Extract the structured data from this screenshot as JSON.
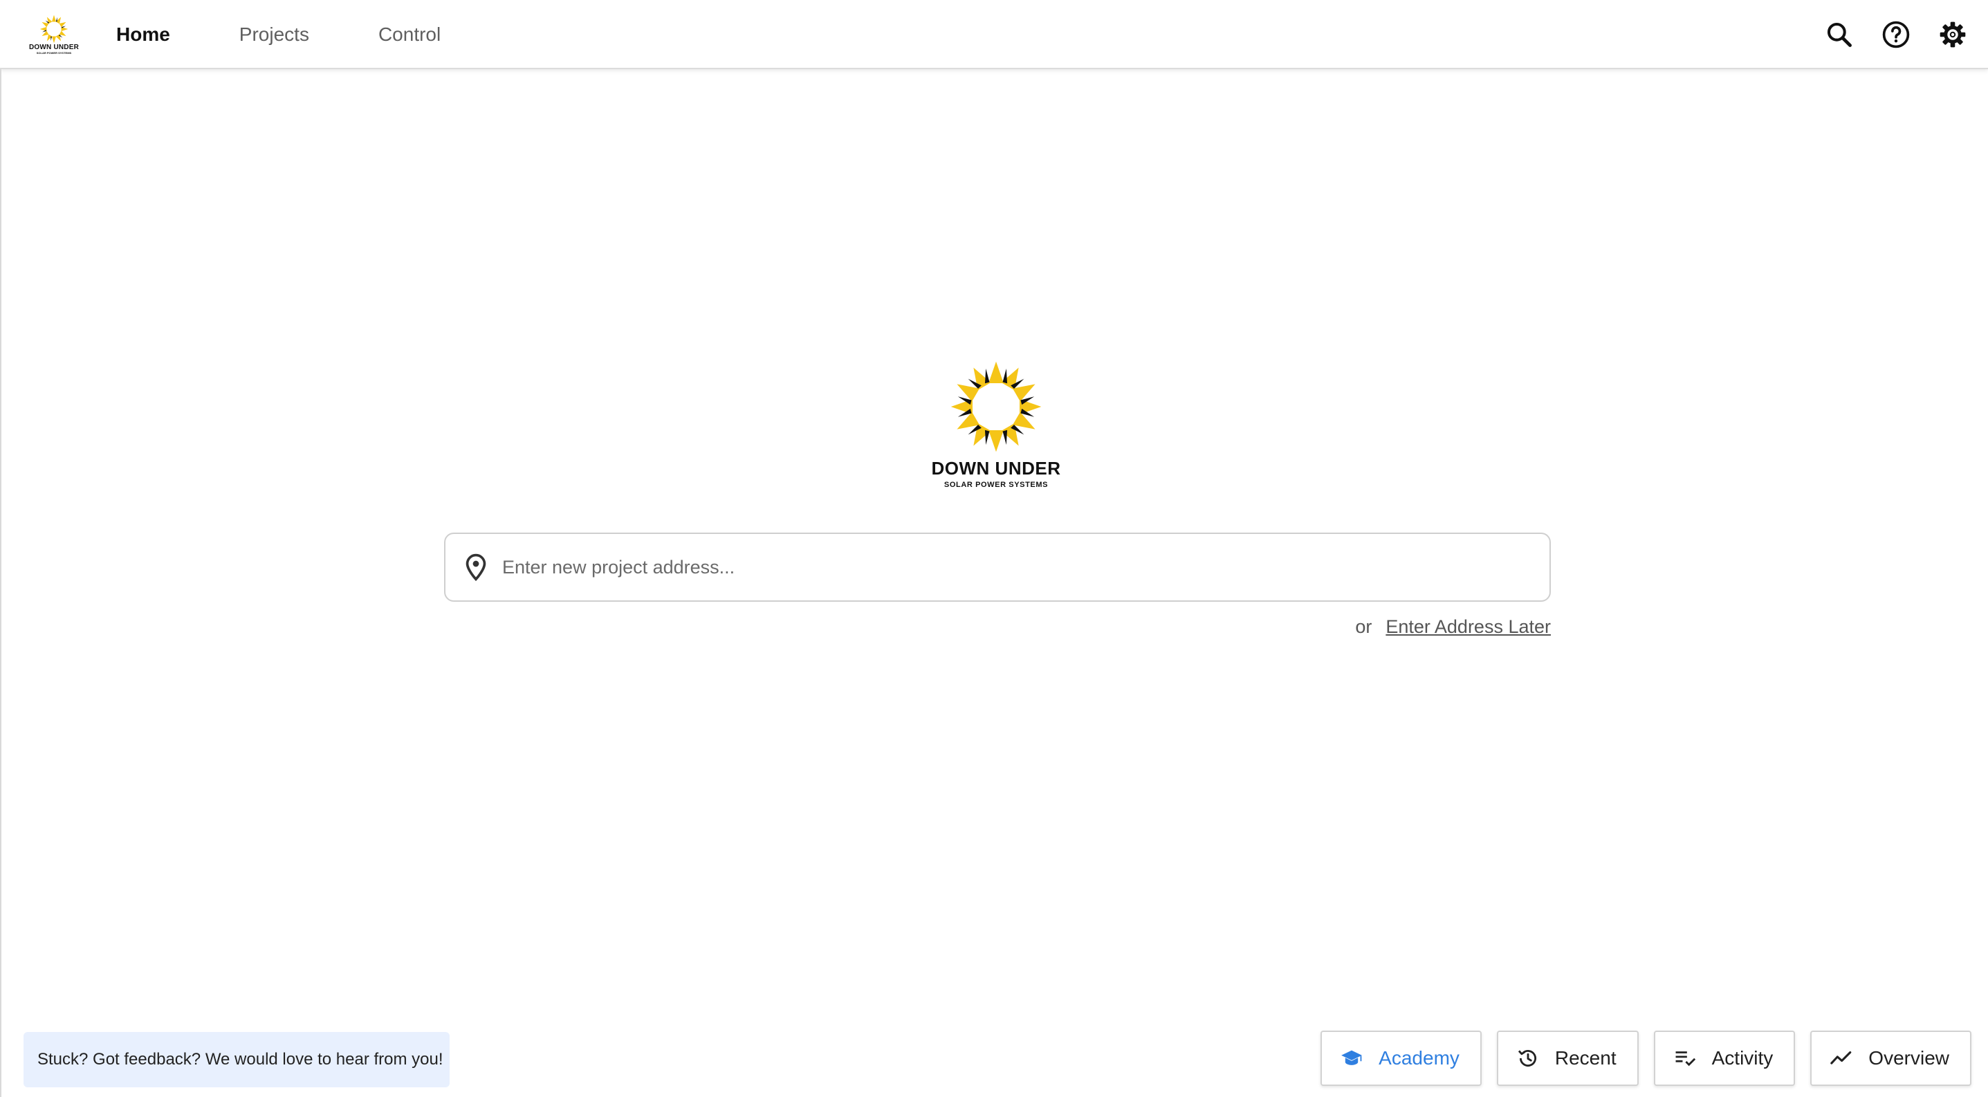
{
  "brand": {
    "name": "DOWN UNDER",
    "tagline": "SOLAR POWER SYSTEMS"
  },
  "nav": {
    "items": [
      {
        "label": "Home",
        "active": true
      },
      {
        "label": "Projects",
        "active": false
      },
      {
        "label": "Control",
        "active": false
      }
    ]
  },
  "top_icons": [
    "search-icon",
    "help-icon",
    "gear-icon"
  ],
  "address": {
    "placeholder": "Enter new project address...",
    "value": "",
    "or_text": "or",
    "later_link": "Enter Address Later"
  },
  "feedback": {
    "text": "Stuck? Got feedback? We would love to hear from you!"
  },
  "bottom_buttons": [
    {
      "label": "Academy",
      "icon": "graduation-cap-icon"
    },
    {
      "label": "Recent",
      "icon": "history-icon"
    },
    {
      "label": "Activity",
      "icon": "checklist-icon"
    },
    {
      "label": "Overview",
      "icon": "trend-icon"
    }
  ],
  "colors": {
    "accent": "#2f7fe0",
    "sun_yellow": "#f5c518",
    "feedback_bg": "#e8f0fe"
  }
}
